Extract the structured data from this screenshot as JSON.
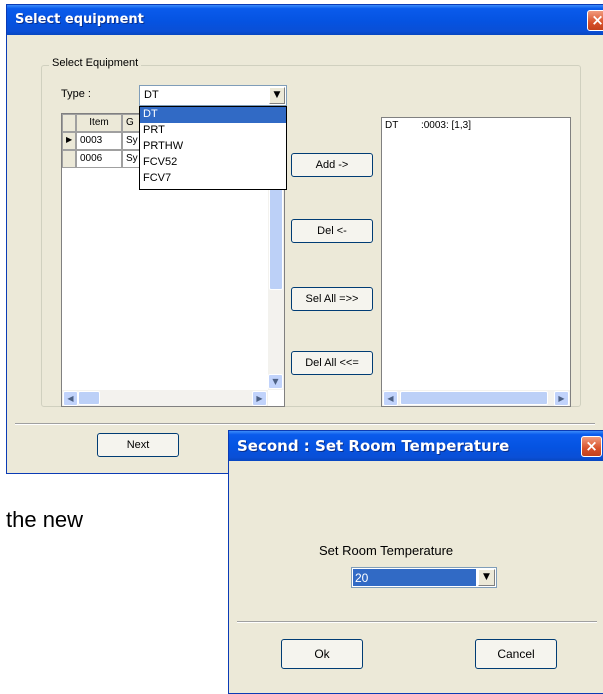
{
  "select_window": {
    "title": "Select equipment",
    "group_label": "Select Equipment",
    "type_label": "Type :",
    "type_value": "DT",
    "dropdown_options": [
      "DT",
      "PRT",
      "PRTHW",
      "FCV52",
      "FCV7"
    ],
    "grid_header_item": "Item",
    "grid_header_g": "G",
    "grid_rows": [
      {
        "item": "0003",
        "g": "Sy"
      },
      {
        "item": "0006",
        "g": "Sy"
      }
    ],
    "selected_entries": [
      {
        "type": "DT",
        "detail": ":0003: [1,3]"
      }
    ],
    "buttons": {
      "add": "Add ->",
      "del": "Del <-",
      "sel_all": "Sel All =>>",
      "del_all": "Del All <<=",
      "next": "Next"
    }
  },
  "background_text": "the new",
  "temp_dialog": {
    "title": "Second : Set Room Temperature",
    "label": "Set Room Temperature",
    "value": "20",
    "ok": "Ok",
    "cancel": "Cancel"
  }
}
